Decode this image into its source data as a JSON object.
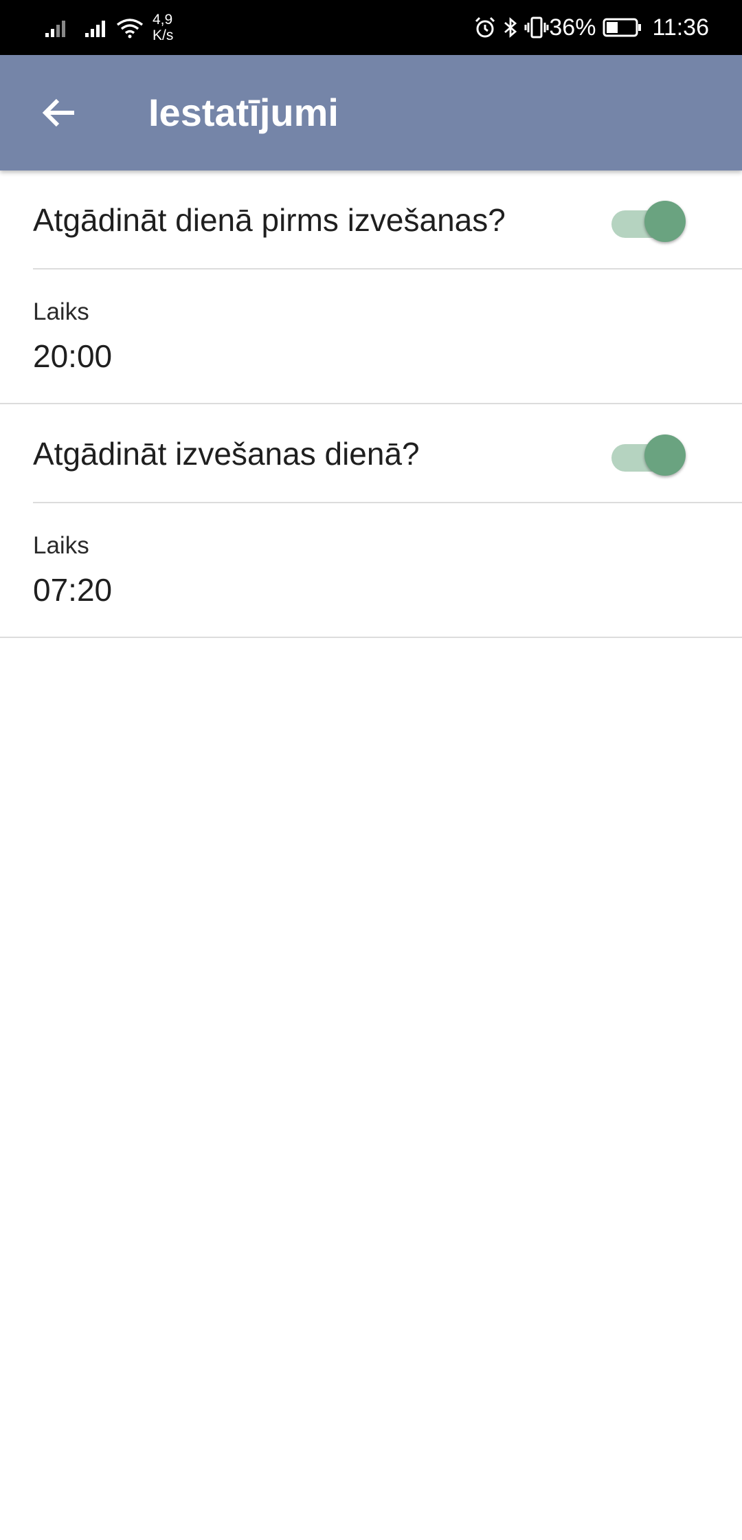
{
  "status_bar": {
    "net_speed_value": "4,9",
    "net_speed_unit": "K/s",
    "battery_percent": "36%",
    "time": "11:36",
    "icons": [
      "signal-icon",
      "signal-icon",
      "wifi-icon",
      "alarm-icon",
      "bluetooth-icon",
      "vibrate-icon",
      "battery-icon"
    ]
  },
  "app_bar": {
    "title": "Iestatījumi",
    "back_icon": "arrow-left-icon",
    "color": "#7585a8"
  },
  "settings": {
    "before_day": {
      "label": "Atgādināt dienā pirms izvešanas?",
      "enabled": true,
      "time_caption": "Laiks",
      "time_value": "20:00"
    },
    "same_day": {
      "label": "Atgādināt izvešanas dienā?",
      "enabled": true,
      "time_caption": "Laiks",
      "time_value": "07:20"
    }
  },
  "colors": {
    "switch_thumb": "#6aa380",
    "switch_track": "#b5d3c0",
    "divider": "#dcdcdc"
  }
}
